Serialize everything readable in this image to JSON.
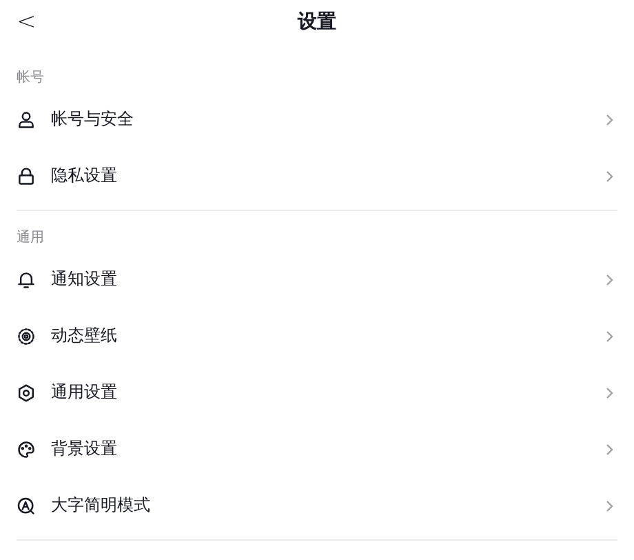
{
  "header": {
    "back": "<",
    "title": "设置"
  },
  "sections": [
    {
      "label": "帐号",
      "items": [
        {
          "kind": "person",
          "label": "帐号与安全"
        },
        {
          "kind": "lock",
          "label": "隐私设置"
        }
      ]
    },
    {
      "label": "通用",
      "items": [
        {
          "kind": "bell",
          "label": "通知设置"
        },
        {
          "kind": "wallpaper",
          "label": "动态壁纸"
        },
        {
          "kind": "gear",
          "label": "通用设置"
        },
        {
          "kind": "palette",
          "label": "背景设置"
        },
        {
          "kind": "font",
          "label": "大字简明模式"
        }
      ]
    }
  ]
}
